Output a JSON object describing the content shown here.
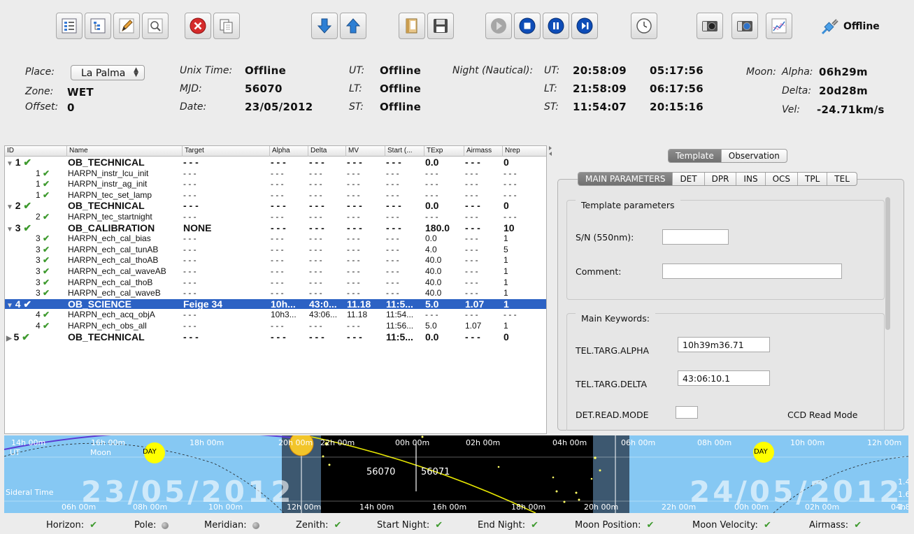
{
  "toolbar": {
    "connection_label": "Offline"
  },
  "info": {
    "place_label": "Place:",
    "place_value": "La Palma",
    "zone_label": "Zone:",
    "zone_value": "WET",
    "offset_label": "Offset:",
    "offset_value": "0",
    "unix_label": "Unix Time:",
    "unix_value": "Offline",
    "mjd_label": "MJD:",
    "mjd_value": "56070",
    "date_label": "Date:",
    "date_value": "23/05/2012",
    "ut_label": "UT:",
    "ut_value": "Offline",
    "lt_label": "LT:",
    "lt_value": "Offline",
    "st_label": "ST:",
    "st_value": "Offline",
    "night_label": "Night (Nautical):",
    "n_ut_label": "UT:",
    "n_ut_start": "20:58:09",
    "n_ut_end": "05:17:56",
    "n_lt_label": "LT:",
    "n_lt_start": "21:58:09",
    "n_lt_end": "06:17:56",
    "n_st_label": "ST:",
    "n_st_start": "11:54:07",
    "n_st_end": "20:15:16",
    "moon_label": "Moon:",
    "alpha_label": "Alpha:",
    "alpha_value": "06h29m",
    "delta_label": "Delta:",
    "delta_value": "20d28m",
    "vel_label": "Vel:",
    "vel_value": "-24.71km/s"
  },
  "table": {
    "headers": [
      "ID",
      "Name",
      "Target",
      "Alpha",
      "Delta",
      "MV",
      "Start (...",
      "TExp",
      "Airmass",
      "Nrep"
    ],
    "rows": [
      {
        "id": "1",
        "name": "OB_TECHNICAL",
        "target": "- - -",
        "alpha": "- - -",
        "delta": "- - -",
        "mv": "- - -",
        "start": "- - -",
        "texp": "0.0",
        "airmass": "- - -",
        "nrep": "0"
      },
      {
        "id": "1",
        "name": "HARPN_instr_lcu_init",
        "target": "- - -",
        "alpha": "- - -",
        "delta": "- - -",
        "mv": "- - -",
        "start": "- - -",
        "texp": "- - -",
        "airmass": "- - -",
        "nrep": "- - -"
      },
      {
        "id": "1",
        "name": "HARPN_instr_ag_init",
        "target": "- - -",
        "alpha": "- - -",
        "delta": "- - -",
        "mv": "- - -",
        "start": "- - -",
        "texp": "- - -",
        "airmass": "- - -",
        "nrep": "- - -"
      },
      {
        "id": "1",
        "name": "HARPN_tec_set_lamp",
        "target": "- - -",
        "alpha": "- - -",
        "delta": "- - -",
        "mv": "- - -",
        "start": "- - -",
        "texp": "- - -",
        "airmass": "- - -",
        "nrep": "- - -"
      },
      {
        "id": "2",
        "name": "OB_TECHNICAL",
        "target": "- - -",
        "alpha": "- - -",
        "delta": "- - -",
        "mv": "- - -",
        "start": "- - -",
        "texp": "0.0",
        "airmass": "- - -",
        "nrep": "0"
      },
      {
        "id": "2",
        "name": "HARPN_tec_startnight",
        "target": "- - -",
        "alpha": "- - -",
        "delta": "- - -",
        "mv": "- - -",
        "start": "- - -",
        "texp": "- - -",
        "airmass": "- - -",
        "nrep": "- - -"
      },
      {
        "id": "3",
        "name": "OB_CALIBRATION",
        "target": "NONE",
        "alpha": "- - -",
        "delta": "- - -",
        "mv": "- - -",
        "start": "- - -",
        "texp": "180.0",
        "airmass": "- - -",
        "nrep": "10"
      },
      {
        "id": "3",
        "name": "HARPN_ech_cal_bias",
        "target": "- - -",
        "alpha": "- - -",
        "delta": "- - -",
        "mv": "- - -",
        "start": "- - -",
        "texp": "0.0",
        "airmass": "- - -",
        "nrep": "1"
      },
      {
        "id": "3",
        "name": "HARPN_ech_cal_tunAB",
        "target": "- - -",
        "alpha": "- - -",
        "delta": "- - -",
        "mv": "- - -",
        "start": "- - -",
        "texp": "4.0",
        "airmass": "- - -",
        "nrep": "5"
      },
      {
        "id": "3",
        "name": "HARPN_ech_cal_thoAB",
        "target": "- - -",
        "alpha": "- - -",
        "delta": "- - -",
        "mv": "- - -",
        "start": "- - -",
        "texp": "40.0",
        "airmass": "- - -",
        "nrep": "1"
      },
      {
        "id": "3",
        "name": "HARPN_ech_cal_waveAB",
        "target": "- - -",
        "alpha": "- - -",
        "delta": "- - -",
        "mv": "- - -",
        "start": "- - -",
        "texp": "40.0",
        "airmass": "- - -",
        "nrep": "1"
      },
      {
        "id": "3",
        "name": "HARPN_ech_cal_thoB",
        "target": "- - -",
        "alpha": "- - -",
        "delta": "- - -",
        "mv": "- - -",
        "start": "- - -",
        "texp": "40.0",
        "airmass": "- - -",
        "nrep": "1"
      },
      {
        "id": "3",
        "name": "HARPN_ech_cal_waveB",
        "target": "- - -",
        "alpha": "- - -",
        "delta": "- - -",
        "mv": "- - -",
        "start": "- - -",
        "texp": "40.0",
        "airmass": "- - -",
        "nrep": "1"
      },
      {
        "id": "4",
        "name": "OB_SCIENCE",
        "target": "Feige 34",
        "alpha": "10h...",
        "delta": "43:0...",
        "mv": "11.18",
        "start": "11:5...",
        "texp": "5.0",
        "airmass": "1.07",
        "nrep": "1"
      },
      {
        "id": "4",
        "name": "HARPN_ech_acq_objA",
        "target": "- - -",
        "alpha": "10h3...",
        "delta": "43:06...",
        "mv": "11.18",
        "start": "11:54...",
        "texp": "- - -",
        "airmass": "- - -",
        "nrep": "- - -"
      },
      {
        "id": "4",
        "name": "HARPN_ech_obs_all",
        "target": "- - -",
        "alpha": "- - -",
        "delta": "- - -",
        "mv": "- - -",
        "start": "11:56...",
        "texp": "5.0",
        "airmass": "1.07",
        "nrep": "1"
      },
      {
        "id": "5",
        "name": "OB_TECHNICAL",
        "target": "- - -",
        "alpha": "- - -",
        "delta": "- - -",
        "mv": "- - -",
        "start": "11:5...",
        "texp": "0.0",
        "airmass": "- - -",
        "nrep": "0"
      }
    ]
  },
  "right_panel": {
    "view_tabs": [
      "Template",
      "Observation"
    ],
    "param_tabs": [
      "MAIN PARAMETERS",
      "DET",
      "DPR",
      "INS",
      "OCS",
      "TPL",
      "TEL"
    ],
    "template_group_title": "Template parameters",
    "sn_label": "S/N (550nm):",
    "sn_value": "",
    "comment_label": "Comment:",
    "comment_value": "",
    "keywords_group_title": "Main Keywords:",
    "alpha_label": "TEL.TARG.ALPHA",
    "alpha_value": "10h39m36.71",
    "delta_label": "TEL.TARG.DELTA",
    "delta_value": "43:06:10.1",
    "readmode_label": "DET.READ.MODE",
    "ccd_label": "CCD Read Mode"
  },
  "timeline": {
    "ut_label": "UT",
    "moon_label": "Moon",
    "sidereal_label": "Sideral Time",
    "day_label": "DAY",
    "date_left": "23/05/2012",
    "date_right": "24/05/2012",
    "mjd_left": "56070",
    "mjd_right": "56071",
    "ut_ticks": [
      "14h 00m",
      "16h 00m",
      "18h 00m",
      "20h 00m",
      "22h 00m",
      "00h 00m",
      "02h 00m",
      "04h 00m",
      "06h 00m",
      "08h 00m",
      "10h 00m",
      "12h 00m"
    ],
    "st_ticks": [
      "06h 00m",
      "08h 00m",
      "10h 00m",
      "12h 00m",
      "14h 00m",
      "16h 00m",
      "18h 00m",
      "20h 00m",
      "22h 00m",
      "00h 00m",
      "02h 00m",
      "04h 0"
    ],
    "airmass_ticks": [
      "1.4",
      "1.6",
      "1.8"
    ],
    "colors": {
      "day": "#86c8f3",
      "twilight": "#3d5870",
      "night": "#000000",
      "moon": "#ffff00"
    }
  },
  "status": {
    "items": [
      {
        "label": "Horizon:",
        "state": "ok"
      },
      {
        "label": "Pole:",
        "state": "off"
      },
      {
        "label": "Meridian:",
        "state": "off"
      },
      {
        "label": "Zenith:",
        "state": "ok"
      },
      {
        "label": "Start Night:",
        "state": "ok"
      },
      {
        "label": "End Night:",
        "state": "ok"
      },
      {
        "label": "Moon Position:",
        "state": "ok"
      },
      {
        "label": "Moon Velocity:",
        "state": "ok"
      },
      {
        "label": "Airmass:",
        "state": "ok"
      }
    ],
    "check_glyph": "✔"
  }
}
